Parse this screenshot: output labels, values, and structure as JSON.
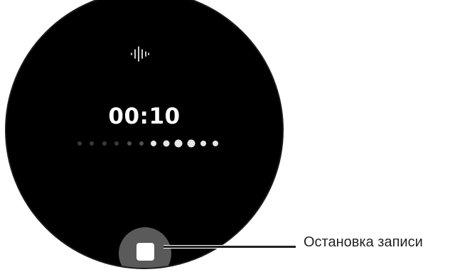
{
  "screen": {
    "icon": "voice-waveform-icon",
    "elapsed_time": "00:10",
    "level_meter": {
      "total_dots": 12,
      "active_dots": 5,
      "peak_dot_index": 9
    },
    "stop_button": {
      "icon": "stop-icon"
    }
  },
  "annotation": {
    "label": "Остановка записи"
  },
  "colors": {
    "face": "#000000",
    "text": "#ffffff",
    "dot_inactive": "#4a4a4a",
    "dot_active": "#e6e6e6",
    "button": "#5a5a5a",
    "callout": "#222222"
  }
}
